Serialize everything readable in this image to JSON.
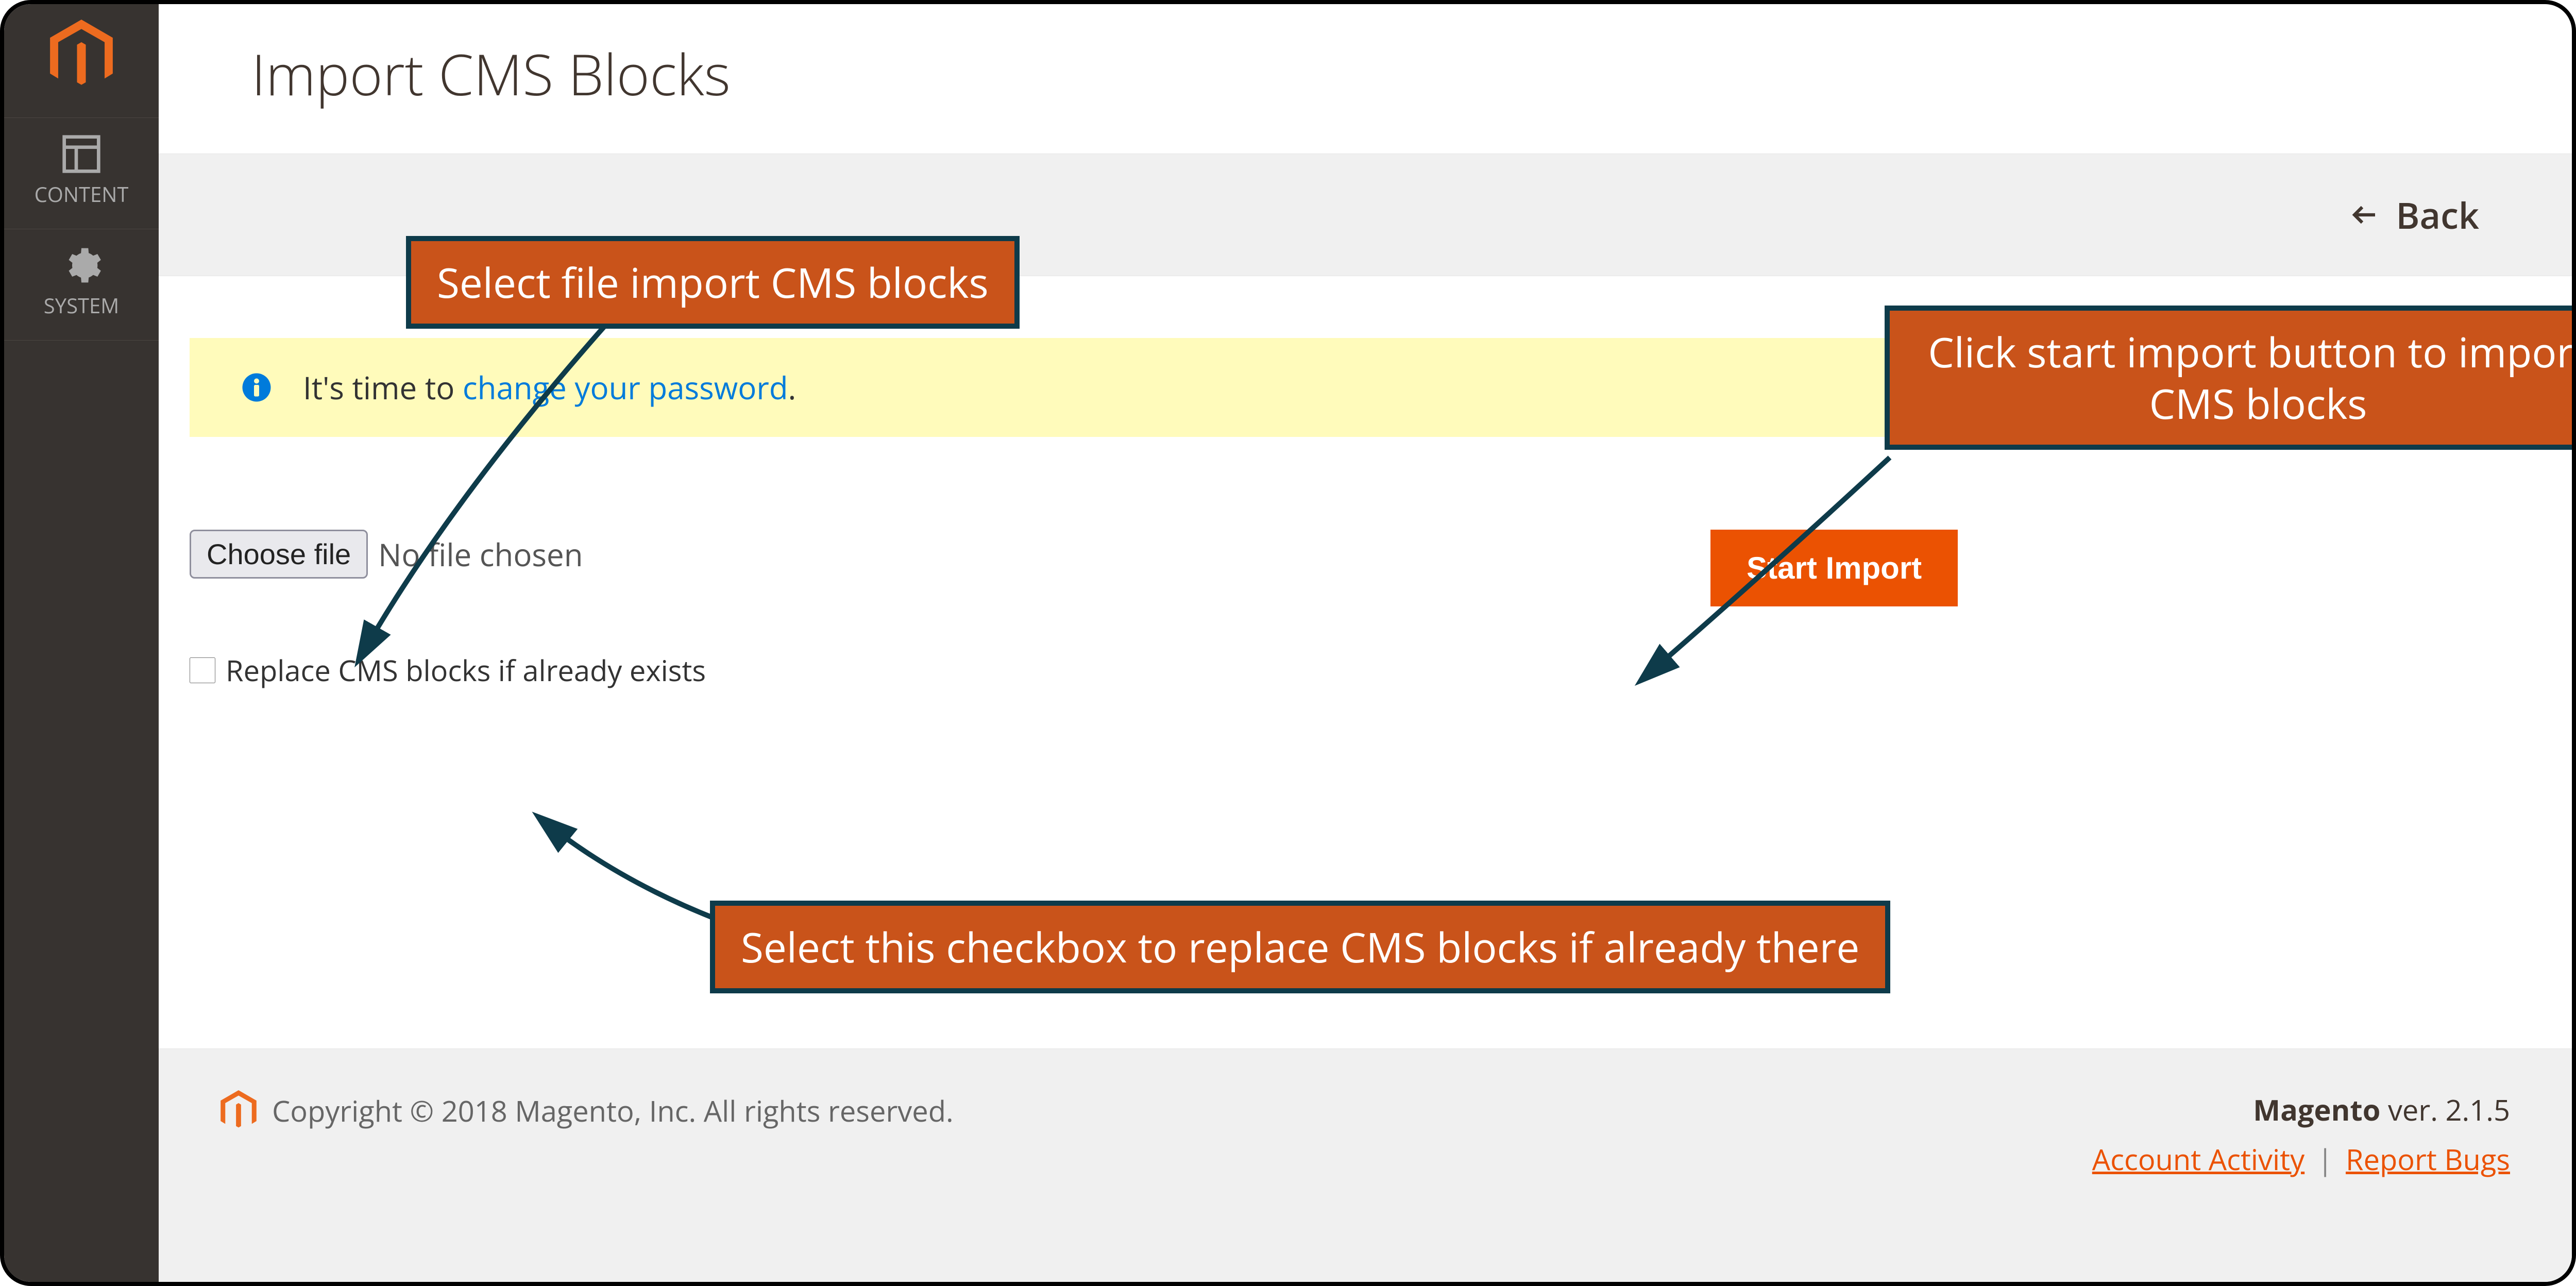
{
  "sidebar": {
    "items": [
      {
        "label": "CONTENT"
      },
      {
        "label": "SYSTEM"
      }
    ]
  },
  "page": {
    "title": "Import CMS Blocks"
  },
  "toolbar": {
    "back_label": "Back"
  },
  "notice": {
    "prefix": "It's time to ",
    "link_text": "change your password",
    "suffix": "."
  },
  "form": {
    "choose_file_label": "Choose file",
    "file_status": "No file chosen",
    "replace_label": "Replace CMS blocks if already exists",
    "start_import_label": "Start Import"
  },
  "footer": {
    "copyright": "Copyright © 2018 Magento, Inc. All rights reserved.",
    "brand": "Magento",
    "version_text": " ver. 2.1.5",
    "account_activity": "Account Activity",
    "report_bugs": "Report Bugs"
  },
  "callouts": {
    "c1": "Select file import CMS blocks",
    "c2": "Click start import button to import CMS blocks",
    "c3": "Select this checkbox to replace CMS blocks if already there"
  }
}
